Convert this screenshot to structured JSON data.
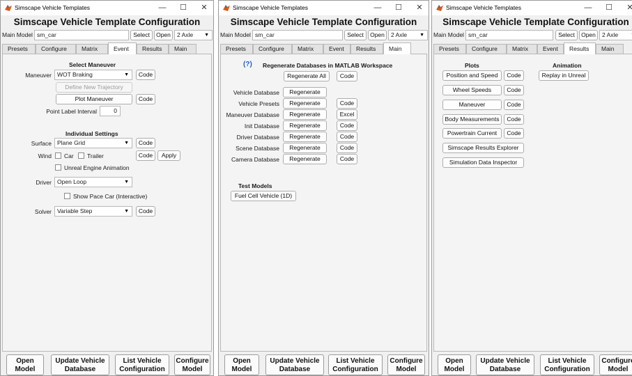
{
  "window": {
    "title": "Simscape Vehicle Templates",
    "heading": "Simscape Vehicle Template Configuration",
    "minimize": "—",
    "maximize": "☐",
    "close": "✕",
    "main_model_label": "Main Model",
    "main_model_value": "sm_car",
    "select_label": "Select",
    "open_label": "Open",
    "axle_value": "2 Axle"
  },
  "tabs": [
    "Presets",
    "Configure",
    "Matrix",
    "Event",
    "Results",
    "Main"
  ],
  "footer": {
    "open_model": [
      "Open",
      "Model"
    ],
    "update_db": [
      "Update Vehicle",
      "Database"
    ],
    "list_config": [
      "List Vehicle",
      "Configuration"
    ],
    "configure_model": [
      "Configure",
      "Model"
    ]
  },
  "event": {
    "select_maneuver": "Select Maneuver",
    "maneuver_label": "Maneuver",
    "maneuver_value": "WOT Braking",
    "code": "Code",
    "define_traj": "Define New Trajectory",
    "plot_maneuver": "Plot Maneuver",
    "point_label_interval": "Point Label Interval",
    "point_label_value": "0",
    "individual_settings": "Individual Settings",
    "surface_label": "Surface",
    "surface_value": "Plane Grid",
    "wind_label": "Wind",
    "car_label": "Car",
    "trailer_label": "Trailer",
    "apply_label": "Apply",
    "unreal_anim": "Unreal Engine Animation",
    "driver_label": "Driver",
    "driver_value": "Open Loop",
    "pace_car": "Show Pace Car (Interactive)",
    "solver_label": "Solver",
    "solver_value": "Variable Step"
  },
  "main_tab": {
    "help": "(?)",
    "regen_title": "Regenerate Databases in MATLAB Workspace",
    "regen_all": "Regenerate All",
    "regen": "Regenerate",
    "code": "Code",
    "excel": "Excel",
    "rows": [
      {
        "label": "Vehicle Database",
        "action": "none"
      },
      {
        "label": "Vehicle Presets",
        "action": "Code"
      },
      {
        "label": "Maneuver Database",
        "action": "Excel"
      },
      {
        "label": "Init Database",
        "action": "Code"
      },
      {
        "label": "Driver Database",
        "action": "Code"
      },
      {
        "label": "Scene Database",
        "action": "Code"
      },
      {
        "label": "Camera Database",
        "action": "Code"
      }
    ],
    "test_models": "Test Models",
    "fuel_cell": "Fuel Cell Vehicle (1D)"
  },
  "results_tab": {
    "plots": "Plots",
    "animation": "Animation",
    "code": "Code",
    "position_speed": "Position and Speed",
    "wheel_speeds": "Wheel Speeds",
    "maneuver": "Maneuver",
    "body_meas": "Body Measurements",
    "powertrain": "Powertrain Current",
    "results_explorer": "Simscape Results Explorer",
    "data_inspector": "Simulation Data Inspector",
    "replay_unreal": "Replay in Unreal"
  }
}
